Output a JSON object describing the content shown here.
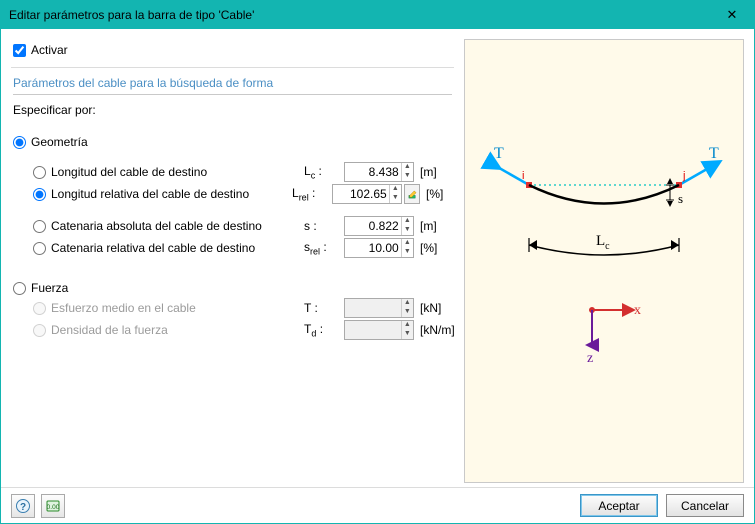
{
  "window": {
    "title": "Editar parámetros para la barra de tipo 'Cable'",
    "close_glyph": "✕"
  },
  "activate": {
    "label": "Activar",
    "checked": true
  },
  "section": {
    "title": "Parámetros del cable para la búsqueda de forma"
  },
  "specify": {
    "label": "Especificar por:"
  },
  "geometry": {
    "label": "Geometría",
    "opt_length": "Longitud del cable de destino",
    "opt_relative_length": "Longitud relativa del cable de destino",
    "opt_abs_catenary": "Catenaria absoluta del cable de destino",
    "opt_rel_catenary": "Catenaria relativa del cable de destino",
    "sym_Lc": "L",
    "sub_c": "c",
    "sym_Lrel": "L",
    "sub_rel": "rel",
    "sym_s": "s",
    "sym_srel": "s",
    "sub_srel": "rel",
    "val_Lc": "8.438",
    "val_Lrel": "102.65",
    "val_s": "0.822",
    "val_srel": "10.00",
    "unit_m": "[m]",
    "unit_pct": "[%]"
  },
  "force": {
    "label": "Fuerza",
    "opt_avg": "Esfuerzo medio en el cable",
    "opt_density": "Densidad de la fuerza",
    "sym_T": "T",
    "sym_Td": "T",
    "sub_d": "d",
    "val_T": "",
    "val_Td": "",
    "unit_kn": "[kN]",
    "unit_knm": "[kN/m]"
  },
  "diagram": {
    "T": "T",
    "i": "i",
    "j": "j",
    "s": "s",
    "Lc": "L",
    "Lc_sub": "c",
    "x": "x",
    "z": "z"
  },
  "footer": {
    "accept": "Aceptar",
    "cancel": "Cancelar"
  }
}
